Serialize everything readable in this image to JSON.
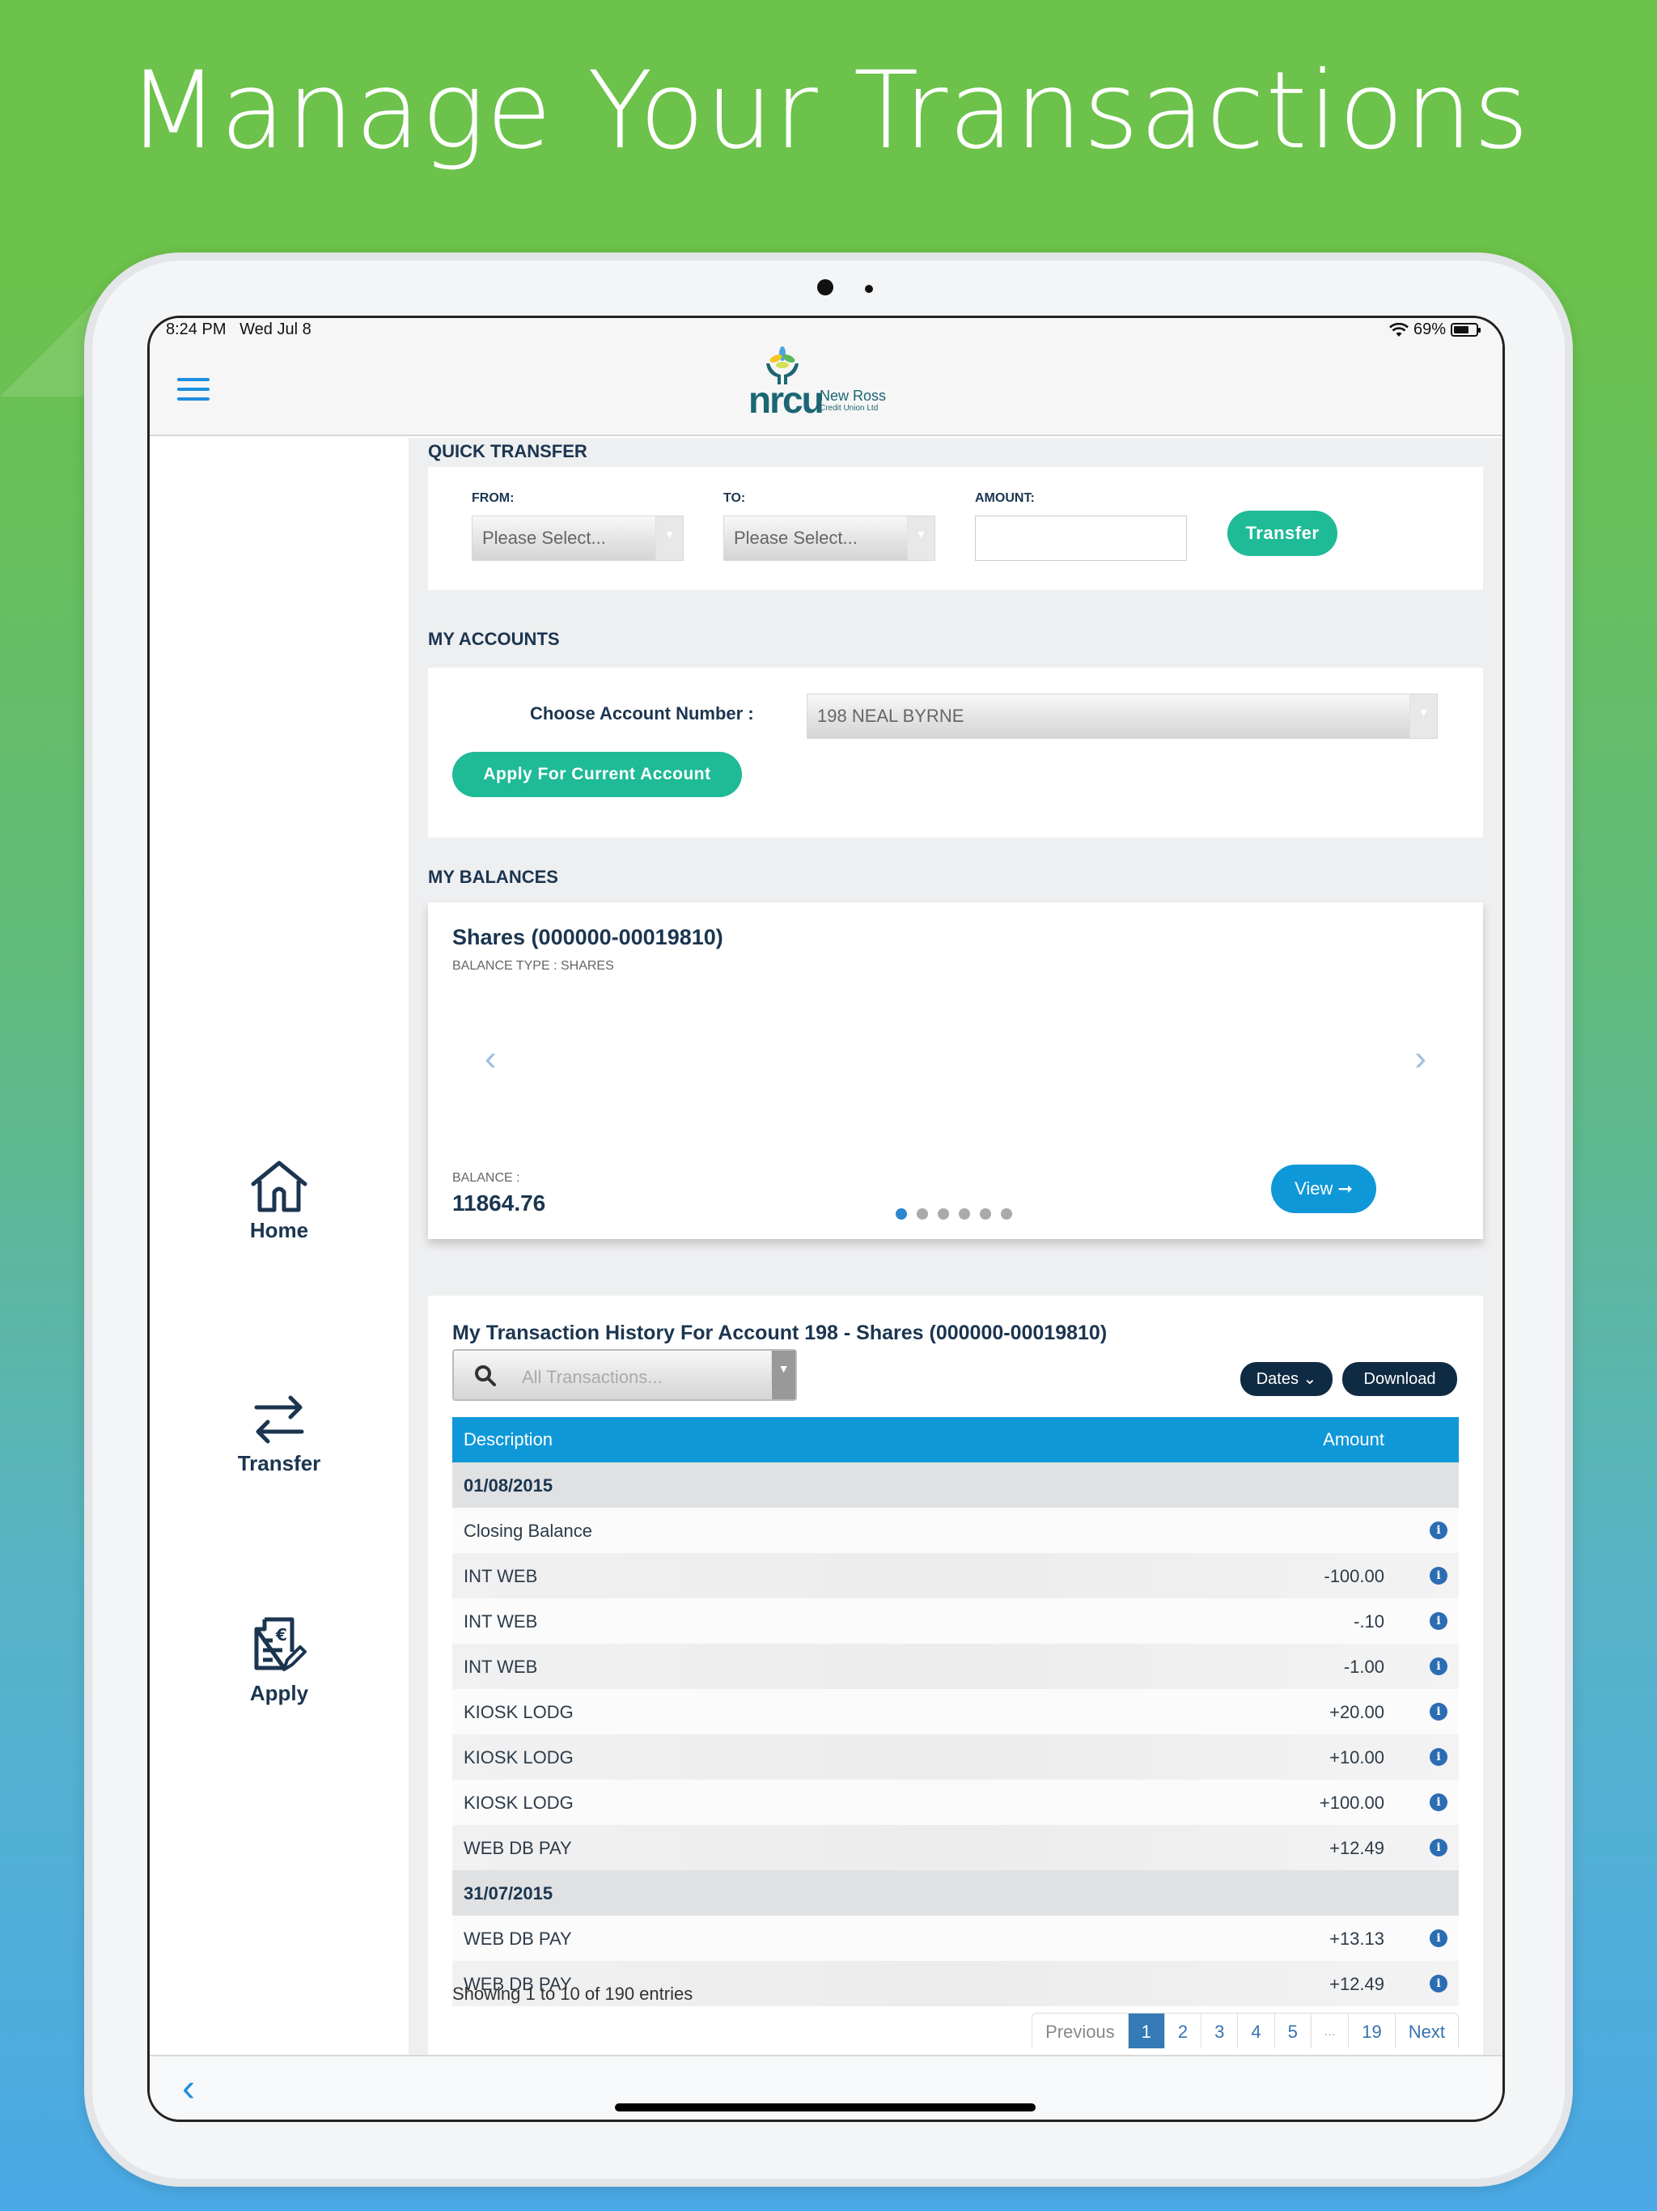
{
  "headline": "Manage Your Transactions",
  "status_bar": {
    "time": "8:24 PM",
    "date": "Wed Jul 8",
    "battery": "69%",
    "battery_level": 0.69
  },
  "app": {
    "logo_mark": "nrcu",
    "logo_name": "New Ross",
    "logo_sub": "Credit Union Ltd"
  },
  "sidebar": {
    "items": [
      {
        "label": "Home",
        "icon": "home-icon"
      },
      {
        "label": "Transfer",
        "icon": "transfer-arrows-icon"
      },
      {
        "label": "Apply",
        "icon": "apply-document-icon"
      }
    ]
  },
  "quick_transfer": {
    "title": "QUICK TRANSFER",
    "from_label": "FROM:",
    "from_value": "Please Select...",
    "to_label": "TO:",
    "to_value": "Please Select...",
    "amount_label": "AMOUNT:",
    "amount_value": "",
    "transfer_button": "Transfer"
  },
  "my_accounts": {
    "title": "MY ACCOUNTS",
    "choose_label": "Choose Account Number :",
    "selected_account": "198 NEAL BYRNE",
    "apply_button": "Apply For Current Account"
  },
  "my_balances": {
    "title": "MY BALANCES",
    "account_name": "Shares (000000-00019810)",
    "balance_type": "BALANCE TYPE : SHARES",
    "balance_label": "BALANCE :",
    "balance_value": "11864.76",
    "view_button": "View ➞",
    "carousel_count": 6,
    "carousel_active": 1,
    "prev_glyph": "‹",
    "next_glyph": "›"
  },
  "transactions": {
    "title": "My Transaction History For Account 198 - Shares (000000-00019810)",
    "filter_placeholder": "All Transactions...",
    "dates_button": "Dates ⌄",
    "download_button": "Download",
    "columns": {
      "description": "Description",
      "amount": "Amount"
    },
    "rows": [
      {
        "type": "date",
        "description": "01/08/2015",
        "amount": ""
      },
      {
        "type": "item",
        "description": "Closing Balance",
        "amount": ""
      },
      {
        "type": "item",
        "description": "INT WEB",
        "amount": "-100.00"
      },
      {
        "type": "item",
        "description": "INT WEB",
        "amount": "-.10"
      },
      {
        "type": "item",
        "description": "INT WEB",
        "amount": "-1.00"
      },
      {
        "type": "item",
        "description": "KIOSK LODG",
        "amount": "+20.00"
      },
      {
        "type": "item",
        "description": "KIOSK LODG",
        "amount": "+10.00"
      },
      {
        "type": "item",
        "description": "KIOSK LODG",
        "amount": "+100.00"
      },
      {
        "type": "item",
        "description": "WEB DB PAY",
        "amount": "+12.49"
      },
      {
        "type": "date",
        "description": "31/07/2015",
        "amount": ""
      },
      {
        "type": "item",
        "description": "WEB DB PAY",
        "amount": "+13.13"
      },
      {
        "type": "item",
        "description": "WEB DB PAY",
        "amount": "+12.49"
      }
    ],
    "info_glyph": "i",
    "showing_text": "Showing 1 to 10 of 190 entries",
    "pagination": [
      "Previous",
      "1",
      "2",
      "3",
      "4",
      "5",
      "...",
      "19",
      "Next"
    ],
    "current_page": "1"
  },
  "bottom_bar": {
    "back_glyph": "‹"
  },
  "colors": {
    "accent_green": "#1fba96",
    "accent_blue": "#0f98d8",
    "navy": "#0f2b44",
    "heading": "#1b3550"
  }
}
